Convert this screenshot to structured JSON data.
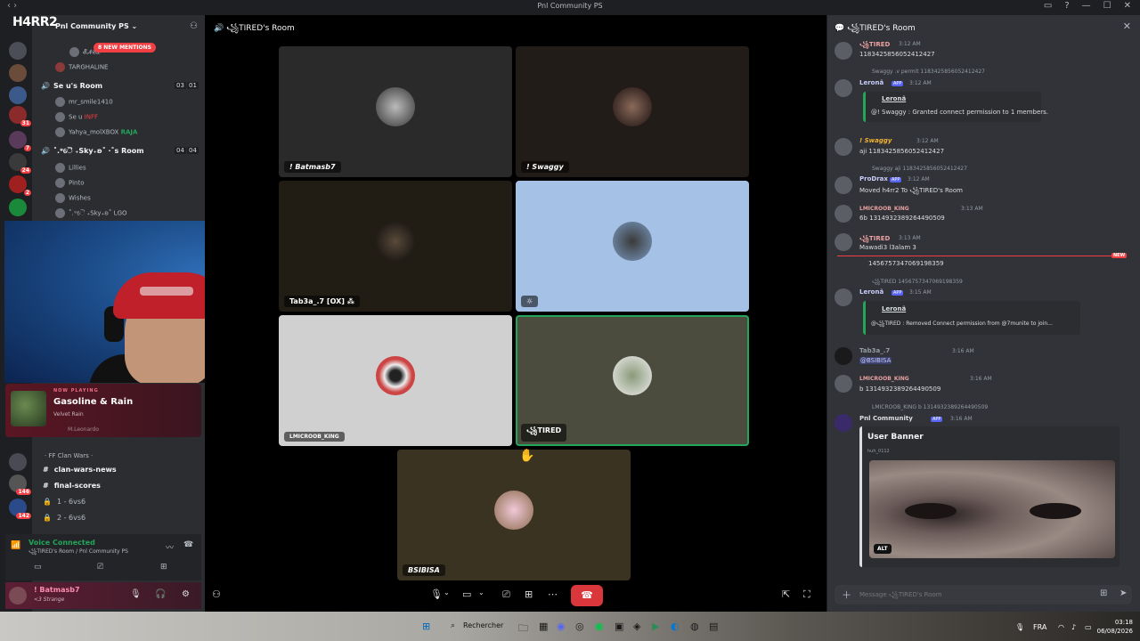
{
  "window": {
    "title": "Pnl Community",
    "title_suffix": "PS",
    "controls": [
      "▭",
      "?",
      "—",
      "☐",
      "✕"
    ]
  },
  "sidebar": {
    "guild_name": "Pnl Community",
    "guild_suffix": "PS",
    "logo_text": "H4RR2",
    "mentions_badge": "8 NEW MENTIONS",
    "members_top": [
      "𝓔𝓝𝓔𝓛",
      "TARGHALINE"
    ],
    "voice_rooms": [
      {
        "name": "Se u's Room",
        "count_a": "03",
        "count_b": "01",
        "members": [
          "mr_smile1410",
          "Se u",
          "Yahya_molXBOX"
        ],
        "member_badges": [
          "",
          "INFF",
          "RAJA"
        ]
      },
      {
        "name": "˚.*ୈ ₊Sky₊ʚ˚ ·˚s Room",
        "count_a": "04",
        "count_b": "04",
        "members": [
          "Lillies",
          "Pinto",
          "Wishes",
          "˚.*ୈ ₊Sky₊ʚ˚"
        ],
        "member_badges": [
          "",
          "",
          "",
          "LGO"
        ]
      }
    ],
    "server_badges": [
      "31",
      "7",
      "24",
      "2"
    ],
    "channels": [
      {
        "label": "· FF Clan Wars ·",
        "icon": "folder"
      },
      {
        "label": "clan-wars-news",
        "icon": "#"
      },
      {
        "label": "final-scores",
        "icon": "#"
      },
      {
        "label": "1 - 6vs6",
        "icon": "lock"
      },
      {
        "label": "2 - 6vs6",
        "icon": "lock"
      }
    ],
    "channel_badges": [
      "146",
      "142"
    ]
  },
  "now_playing": {
    "tag": "NOW PLAYING",
    "title": "Gasoline & Rain",
    "artist": "Velvet Rain",
    "user": "M.Leonardo"
  },
  "voice_panel": {
    "status": "Voice Connected",
    "room": "꧁TIRED's Room / Pnl Community PS"
  },
  "user_panel": {
    "name": "! Batmasb7",
    "status": "<3 Strange"
  },
  "stage": {
    "room_title": "꧁TIRED's Room",
    "tiles": [
      {
        "name": "! Batmasb7"
      },
      {
        "name": "! Swaggy"
      },
      {
        "name": "Tab3a_.7 [OX] ⁂"
      },
      {
        "name": "☼"
      },
      {
        "name": "LMICROOB_KING"
      },
      {
        "name": "꧁TIRED"
      },
      {
        "name": "BSIBISA"
      }
    ]
  },
  "chat": {
    "title": "꧁TIRED's Room",
    "new_tag": "NEW",
    "messages": [
      {
        "author": "꧁TIRED",
        "time": "3:12 AM",
        "text": "1183425856052412427"
      },
      {
        "reply": "Swaggy .v permit 1183425856052412427",
        "author": "Leronã",
        "badge": "APP",
        "time": "3:12 AM",
        "embed_title": "Leronã",
        "embed_text": "@! Swaggy : Granted connect permission to 1 members."
      },
      {
        "author": "! Swaggy",
        "time": "3:12 AM",
        "text": "aji 1183425856052412427"
      },
      {
        "reply": "Swaggy aji 1183425856052412427",
        "author": "ProDrax",
        "badge": "APP",
        "time": "3:12 AM",
        "text": "Moved h4rr2 To ꧁TIRED's Room"
      },
      {
        "author": "LMICROOB_KING",
        "time": "3:13 AM",
        "text": "6b 1314932389264490509"
      },
      {
        "author": "꧁TIRED",
        "time": "3:13 AM",
        "text": "Mawadi3 l3alam 3",
        "text2": "1456757347069198359"
      },
      {
        "reply": "꧁TIRED 1456757347069198359",
        "author": "Leronã",
        "badge": "APP",
        "time": "3:15 AM",
        "embed_title": "Leronã",
        "embed_text": "@꧁TIRED : Removed Connect permission from @7munite to join..."
      },
      {
        "author": "Tab3a_.7",
        "time": "3:16 AM",
        "text": "@BSIBISA"
      },
      {
        "author": "LMICROOB_KING",
        "time": "3:16 AM",
        "text": "b 1314932389264490509"
      },
      {
        "reply": "LMICROOB_KING b 1314932389264490509",
        "author": "Pnl Community",
        "badge": "APP",
        "time": "3:16 AM",
        "embed_title": "User Banner",
        "embed_sub": "huh_0112",
        "alt": "ALT"
      }
    ],
    "composer_placeholder": "Message ꧁TIRED's Room"
  },
  "taskbar": {
    "search_label": "Rechercher",
    "lang": "FRA",
    "time": "03:18",
    "date": "06/08/2026"
  },
  "colors": {
    "accent": "#5865f2",
    "hangup": "#da373c",
    "speaking": "#23a55a",
    "mention_badge": "#f23f43"
  }
}
